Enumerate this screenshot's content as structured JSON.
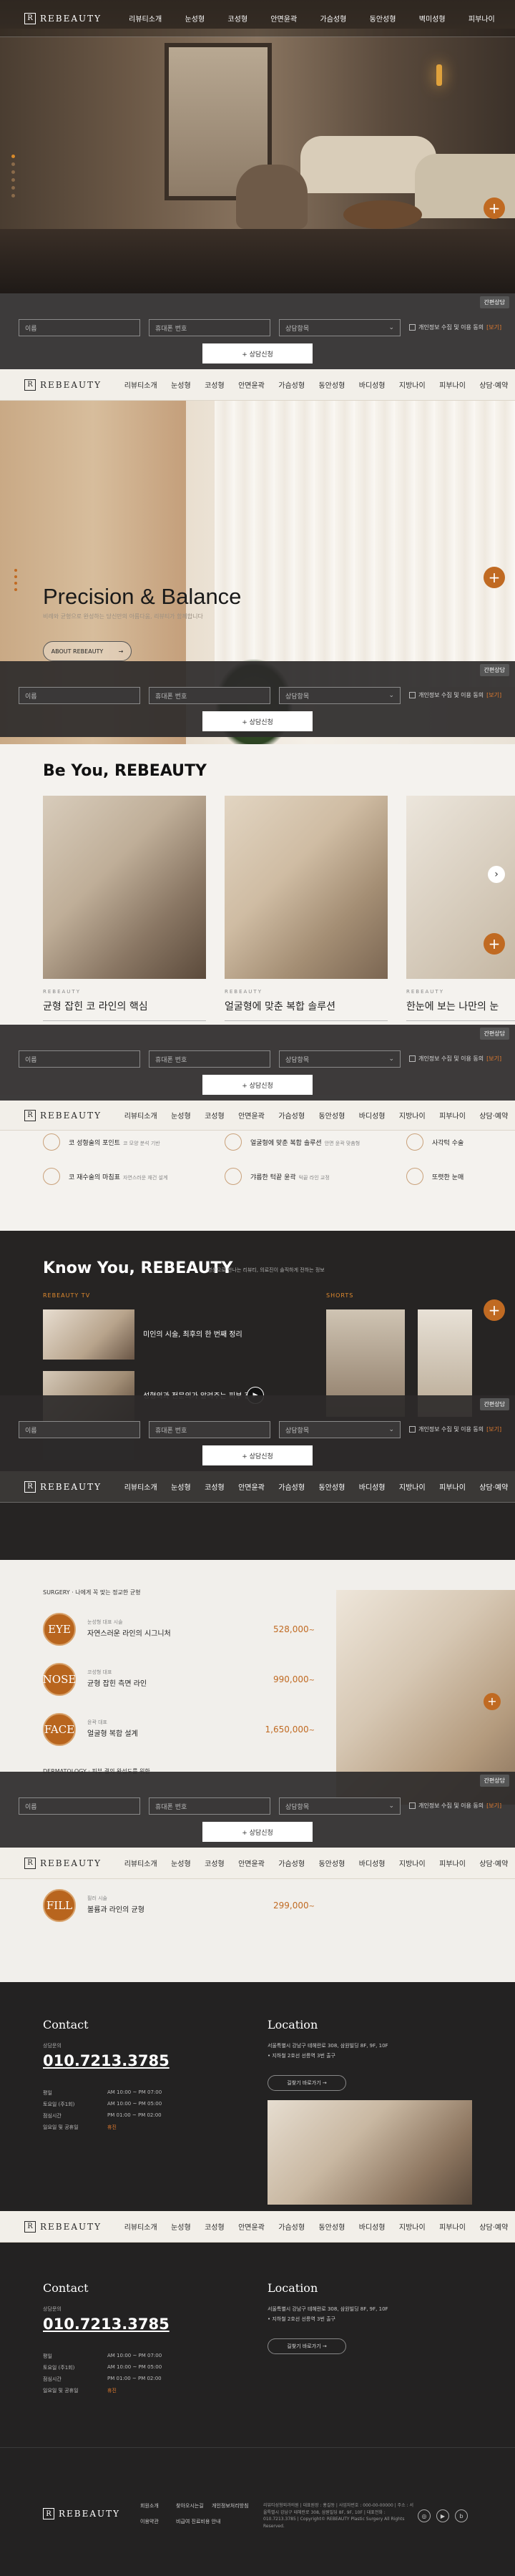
{
  "brand": {
    "logo_mark": "R",
    "name": "REBEAUTY"
  },
  "nav": {
    "items_dark": [
      "리뷰티소개",
      "눈성형",
      "코성형",
      "안면윤곽",
      "가슴성형",
      "동안성형",
      "벽미성형",
      "피부나이"
    ],
    "items_light": [
      "리뷰티소개",
      "눈성형",
      "코성형",
      "안면윤곽",
      "가슴성형",
      "동안성형",
      "바디성형",
      "지방나이",
      "피부나이",
      "상담·예약"
    ]
  },
  "consult": {
    "tab_label": "간편상담",
    "name_placeholder": "이름",
    "phone_placeholder": "휴대폰 번호",
    "select_placeholder": "상담항목",
    "agree_text": "개인정보 수집 및 이용 동의",
    "agree_more": "[보기]",
    "submit": "+ 상담신청"
  },
  "fab_icon": "plus-icon",
  "hero2": {
    "title": "Precision & Balance",
    "subtitle": "비례와 균형으로 완성하는 당신만의 아름다움, 리뷰티가 함께합니다",
    "button": "ABOUT REBEAUTY",
    "button_icon": "arrow-right-icon"
  },
  "beyou": {
    "title": "Be You, REBEAUTY",
    "cards": [
      {
        "brand": "REBEAUTY",
        "title": "균형 잡힌 코 라인의 핵심"
      },
      {
        "brand": "REBEAUTY",
        "title": "얼굴형에 맞춘 복합 솔루션"
      },
      {
        "brand": "REBEAUTY",
        "title": "한눈에 보는 나만의 눈"
      }
    ]
  },
  "treatments": [
    {
      "title": "코 성형술의 포인트",
      "sub": "코 모양 분석 기반"
    },
    {
      "title": "코 재수술의 마침표",
      "sub": "자연스러운 재건 설계"
    },
    {
      "title": "얼굴형에 맞춘 복합 솔루션",
      "sub": "안면 윤곽 맞춤형"
    },
    {
      "title": "갸름한 턱끝 윤곽",
      "sub": "턱끝 라인 교정"
    },
    {
      "title": "사각턱 수술",
      "sub": "하악 각 교정"
    },
    {
      "title": "또렷한 눈매",
      "sub": "눈매교정"
    }
  ],
  "knowyou": {
    "title": "Know You, REBEAUTY",
    "subtitle": "영상으로 만나는 리뷰티, 의료진이 솔직하게 전하는 정보",
    "tv_label": "REBEAUTY TV",
    "shorts_label": "SHORTS",
    "videos": [
      {
        "title": "미인의 시술, 최후의 한 번째 정리"
      },
      {
        "title": "성형외과 전문의가 알려주는 피부 관리법"
      }
    ]
  },
  "surgery": {
    "head": "SURGERY · 나에게 꼭 맞는 정교한 균형",
    "head2": "DERMATOLOGY · 피부 결의 완성도를 위한",
    "items": [
      {
        "badge": "EYE",
        "small": "눈성형 대표 시술",
        "name": "자연스러운 라인의 시그니처",
        "price": "528,000"
      },
      {
        "badge": "NOSE",
        "small": "코성형 대표",
        "name": "균형 잡힌 측면 라인",
        "price": "990,000"
      },
      {
        "badge": "FACE",
        "small": "윤곽 대표",
        "name": "얼굴형 복합 설계",
        "price": "1,650,000"
      },
      {
        "badge": "FILL",
        "small": "필러 시술",
        "name": "볼륨과 라인의 균형",
        "price": "299,000"
      }
    ],
    "price_suffix": "~"
  },
  "contact": {
    "title": "Contact",
    "location_title": "Location",
    "phone_label": "상담문의",
    "phone": "010.7213.3785",
    "hours": [
      {
        "k": "평일",
        "v": "AM 10:00 ~ PM 07:00"
      },
      {
        "k": "토요일 (주1회)",
        "v": "AM 10:00 ~ PM 05:00"
      },
      {
        "k": "점심시간",
        "v": "PM 01:00 ~ PM 02:00"
      },
      {
        "k": "일요일 및 공휴일",
        "v": "휴진"
      }
    ],
    "address1": "서울특별시 강남구 테헤란로 308, 삼원빌딩 8F, 9F, 10F",
    "address2": "• 지하철 2호선 선릉역 3번 출구",
    "map_button": "길찾기 바로가기 →"
  },
  "footer": {
    "links": [
      "회원소개",
      "찾아오시는길",
      "개인정보처리방침",
      "이용약관",
      "비급여 진료비용 안내"
    ],
    "info": "리뷰티성형외과의원 | 대표원장 : 홍길동 | 사업자번호 : 000-00-00000 | 주소 : 서울특별시 강남구 테헤란로 308, 삼원빌딩 8F, 9F, 10F | 대표전화 : 010.7213.3785 | Copyright© REBEAUTY Plastic Surgery All Rights Reserved.",
    "social": [
      "instagram-icon",
      "youtube-icon",
      "blog-icon"
    ]
  }
}
